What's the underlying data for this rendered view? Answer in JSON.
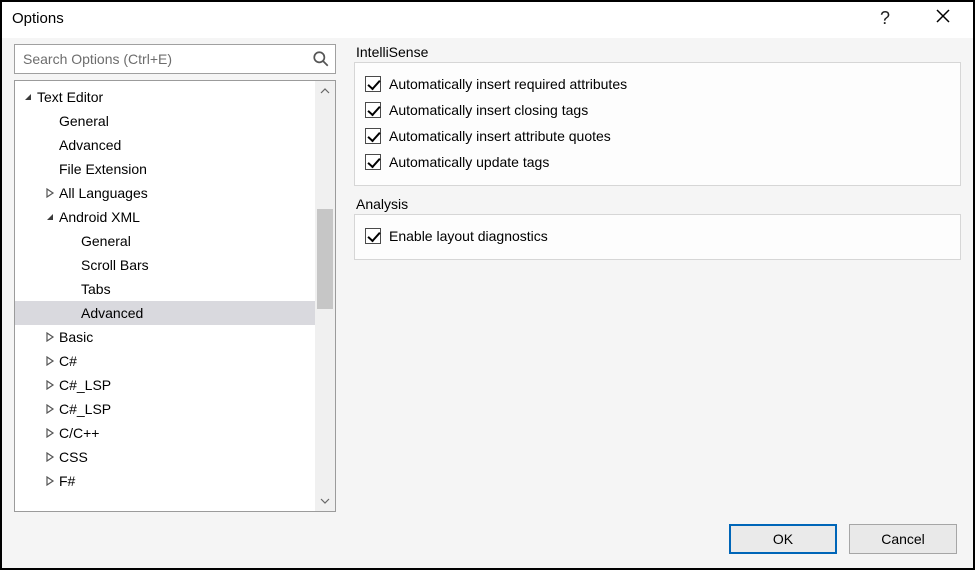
{
  "window": {
    "title": "Options",
    "help_tooltip": "Help",
    "close_tooltip": "Close"
  },
  "search": {
    "placeholder": "Search Options (Ctrl+E)",
    "value": ""
  },
  "tree": {
    "items": [
      {
        "label": "Text Editor",
        "depth": 0,
        "state": "expanded",
        "selected": false
      },
      {
        "label": "General",
        "depth": 1,
        "state": "none",
        "selected": false
      },
      {
        "label": "Advanced",
        "depth": 1,
        "state": "none",
        "selected": false
      },
      {
        "label": "File Extension",
        "depth": 1,
        "state": "none",
        "selected": false
      },
      {
        "label": "All Languages",
        "depth": 1,
        "state": "collapsed",
        "selected": false
      },
      {
        "label": "Android XML",
        "depth": 1,
        "state": "expanded",
        "selected": false
      },
      {
        "label": "General",
        "depth": 2,
        "state": "none",
        "selected": false
      },
      {
        "label": "Scroll Bars",
        "depth": 2,
        "state": "none",
        "selected": false
      },
      {
        "label": "Tabs",
        "depth": 2,
        "state": "none",
        "selected": false
      },
      {
        "label": "Advanced",
        "depth": 2,
        "state": "none",
        "selected": true
      },
      {
        "label": "Basic",
        "depth": 1,
        "state": "collapsed",
        "selected": false
      },
      {
        "label": "C#",
        "depth": 1,
        "state": "collapsed",
        "selected": false
      },
      {
        "label": "C#_LSP",
        "depth": 1,
        "state": "collapsed",
        "selected": false
      },
      {
        "label": "C#_LSP",
        "depth": 1,
        "state": "collapsed",
        "selected": false
      },
      {
        "label": "C/C++",
        "depth": 1,
        "state": "collapsed",
        "selected": false
      },
      {
        "label": "CSS",
        "depth": 1,
        "state": "collapsed",
        "selected": false
      },
      {
        "label": "F#",
        "depth": 1,
        "state": "collapsed",
        "selected": false
      }
    ]
  },
  "groups": [
    {
      "title": "IntelliSense",
      "options": [
        {
          "label": "Automatically insert required attributes",
          "checked": true
        },
        {
          "label": "Automatically insert closing tags",
          "checked": true
        },
        {
          "label": "Automatically insert attribute quotes",
          "checked": true
        },
        {
          "label": "Automatically update tags",
          "checked": true
        }
      ]
    },
    {
      "title": "Analysis",
      "options": [
        {
          "label": "Enable layout diagnostics",
          "checked": true
        }
      ]
    }
  ],
  "buttons": {
    "ok": "OK",
    "cancel": "Cancel"
  }
}
